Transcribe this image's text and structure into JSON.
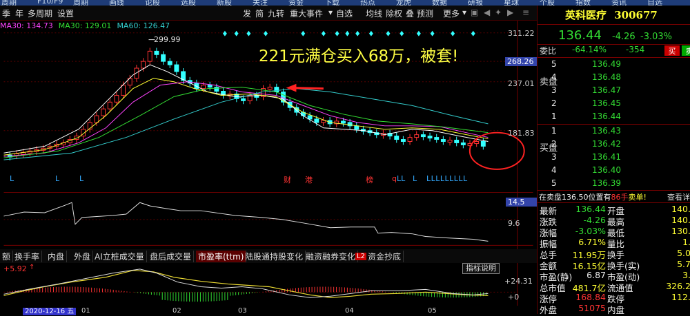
{
  "top_strip": [
    "周期",
    "F10/F9",
    "周期",
    "画线",
    "论股",
    "选股",
    "新股",
    "关注",
    "资金",
    "下载",
    "热点",
    "龙虎",
    "数据",
    "研报",
    "星球",
    "个股",
    "指数",
    "资讯",
    "自选"
  ],
  "toolbar": {
    "period_items": [
      "季",
      "年",
      "多周期",
      "设置"
    ],
    "right_items": [
      "发",
      "简",
      "九转",
      "重大事件",
      "自选",
      "均线",
      "除权",
      "叠",
      "预测",
      "更多"
    ]
  },
  "ma_legend": [
    {
      "label": "MA30: 134.73",
      "color": "#ff44ff"
    },
    {
      "label": "MA30: 129.01",
      "color": "#33dd33"
    },
    {
      "label": "MA60: 126.47",
      "color": "#33cccc"
    }
  ],
  "price_axis": [
    "311.22",
    "268.26",
    "237.01",
    "181.83",
    "14.5",
    "9.6",
    "+24.31",
    "+0"
  ],
  "high_label": "299.99",
  "callout_text": "221元满仓买入68万，被套!",
  "event_markers": [
    "财",
    "港",
    "榜",
    "q",
    "LL",
    "L",
    "LLLLLLLLL"
  ],
  "l_markers": [
    "L",
    "L",
    "L"
  ],
  "indicator_tabs": [
    "额",
    "换手率",
    "内盘",
    "外盘",
    "AI立桩成交量",
    "盘后成交量",
    "市盈率(ttm)",
    "陆股通持股变化",
    "融资融券变化",
    "资金抄底"
  ],
  "active_tab": "市盈率(ttm)",
  "l2_label": "L2",
  "indicator_value": "+5.92",
  "help_button": "指标说明",
  "x_axis": [
    "2020-12-16 五",
    "01",
    "02",
    "03",
    "04",
    "05"
  ],
  "stock": {
    "name": "英科医疗",
    "code": "300677",
    "price": "136.44",
    "change": "-4.26",
    "change_pct": "-3.03%"
  },
  "order_book": {
    "weibi_label": "委比",
    "weibi": "-64.14%",
    "weicha": "-354",
    "sell_btn": "买",
    "buy_btn": "卖",
    "sell_label": "卖盘",
    "buy_label": "买盘",
    "asks": [
      {
        "level": "5",
        "price": "136.49"
      },
      {
        "level": "4",
        "price": "136.48"
      },
      {
        "level": "3",
        "price": "136.47"
      },
      {
        "level": "2",
        "price": "136.45"
      },
      {
        "level": "1",
        "price": "136.44"
      }
    ],
    "bids": [
      {
        "level": "1",
        "price": "136.43"
      },
      {
        "level": "2",
        "price": "136.42"
      },
      {
        "level": "3",
        "price": "136.41"
      },
      {
        "level": "4",
        "price": "136.40"
      },
      {
        "level": "5",
        "price": "136.39"
      }
    ]
  },
  "ticker_line": {
    "text": "在卖盘136.50位置有",
    "count": "86手",
    "tail": "卖单!",
    "more": "查看详"
  },
  "stats": [
    {
      "l": "最新",
      "v": "136.44",
      "vc": "green",
      "l2": "开盘",
      "v2": "140."
    },
    {
      "l": "涨跌",
      "v": "-4.26",
      "vc": "green",
      "l2": "最高",
      "v2": "140."
    },
    {
      "l": "涨幅",
      "v": "-3.03%",
      "vc": "green",
      "l2": "最低",
      "v2": "130."
    },
    {
      "l": "振幅",
      "v": "6.71%",
      "vc": "yellow",
      "l2": "量比",
      "v2": "1."
    },
    {
      "l": "总手",
      "v": "11.95万",
      "vc": "yellow",
      "l2": "换手",
      "v2": "5.0"
    },
    {
      "l": "金额",
      "v": "16.15亿",
      "vc": "yellow",
      "l2": "换手(实)",
      "v2": "5.7"
    },
    {
      "l": "市盈(静)",
      "v": "6.87",
      "vc": "white",
      "l2": "市盈(动)",
      "v2": "3."
    },
    {
      "l": "总市值",
      "v": "481.7亿",
      "vc": "yellow",
      "l2": "流通值",
      "v2": "326.2"
    },
    {
      "l": "涨停",
      "v": "168.84",
      "vc": "red",
      "l2": "跌停",
      "v2": "112."
    },
    {
      "l": "外盘",
      "v": "51075",
      "vc": "red",
      "l2": "内盘",
      "v2": ""
    }
  ]
}
